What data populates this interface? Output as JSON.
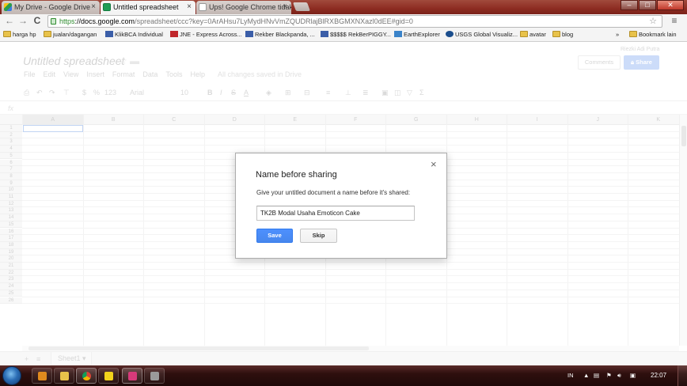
{
  "browser": {
    "tabs": [
      {
        "title": "My Drive - Google Drive",
        "icon": "google-drive-icon",
        "active": false
      },
      {
        "title": "Untitled spreadsheet",
        "icon": "google-sheets-icon",
        "active": true
      },
      {
        "title": "Ups! Google Chrome tidak",
        "icon": "page-icon",
        "active": false
      }
    ],
    "url": {
      "scheme": "https",
      "host": "://docs.google.com",
      "path": "/spreadsheet/ccc?key=0ArAHsu7LyMydHNvVmZQUDRlajBlRXBGMXNXazl0dEE#gid=0"
    },
    "bookmarks": [
      {
        "label": "harga hp",
        "icon": "folder"
      },
      {
        "label": "jualan/dagangan",
        "icon": "folder"
      },
      {
        "label": "KlikBCA Individual",
        "icon": "site"
      },
      {
        "label": "JNE - Express Across...",
        "icon": "jne"
      },
      {
        "label": "Rekber Blackpanda, ...",
        "icon": "site"
      },
      {
        "label": "$$$$$ RekBerPIGGY...",
        "icon": "site"
      },
      {
        "label": "EarthExplorer",
        "icon": "ee"
      },
      {
        "label": "USGS Global Visualiz...",
        "icon": "usgs"
      },
      {
        "label": "avatar",
        "icon": "folder"
      },
      {
        "label": "blog",
        "icon": "folder"
      }
    ],
    "overflow_label": "»",
    "other_bookmarks": "Bookmark lain"
  },
  "app": {
    "doc_title": "Untitled spreadsheet",
    "shared_by": "Riezki Adi Putra",
    "comments_label": "Comments",
    "share_label": "Share",
    "menus": [
      "File",
      "Edit",
      "View",
      "Insert",
      "Format",
      "Data",
      "Tools",
      "Help"
    ],
    "save_status": "All changes saved in Drive",
    "font_name": "Arial",
    "font_size": "10",
    "number_format": "123",
    "fx_label": "fx",
    "columns": [
      "A",
      "B",
      "C",
      "D",
      "E",
      "F",
      "G",
      "H",
      "I",
      "J",
      "K"
    ],
    "rows": [
      "1",
      "2",
      "3",
      "4",
      "5",
      "6",
      "7",
      "8",
      "9",
      "10",
      "11",
      "12",
      "13",
      "14",
      "15",
      "16",
      "17",
      "18",
      "19",
      "20",
      "21",
      "22",
      "23",
      "24",
      "25",
      "26"
    ],
    "sheet_name": "Sheet1"
  },
  "dialog": {
    "title": "Name before sharing",
    "message": "Give your untitled document a name before it's shared:",
    "input_value": "TK2B Modal Usaha Emoticon Cake",
    "save_label": "Save",
    "skip_label": "Skip",
    "close_glyph": "×"
  },
  "taskbar": {
    "language": "IN",
    "time": "22:07"
  }
}
